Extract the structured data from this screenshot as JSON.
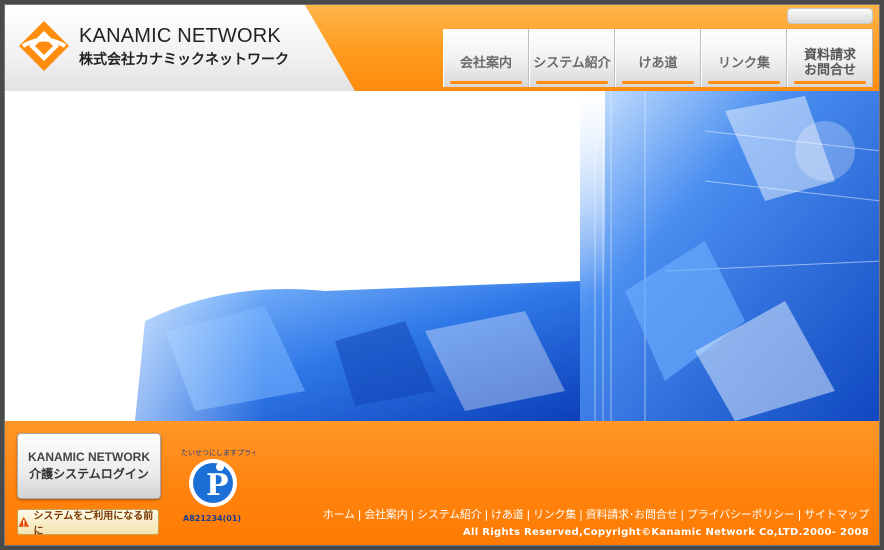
{
  "header": {
    "logo_en": "KANAMIC NETWORK",
    "logo_jp": "株式会社カナミックネットワーク"
  },
  "nav": {
    "items": [
      {
        "label": "会社案内"
      },
      {
        "label": "システム紹介"
      },
      {
        "label": "けあ道"
      },
      {
        "label": "リンク集"
      },
      {
        "label_line1": "資料請求",
        "label_line2": "お問合せ"
      }
    ]
  },
  "footer": {
    "login_line1": "KANAMIC NETWORK",
    "login_line2": "介護システムログイン",
    "notice": "システムをご利用になる前に",
    "pmark_text": "たいせつにしますプライバシー",
    "pmark_code": "A821234(01)",
    "links": [
      "ホーム",
      "会社案内",
      "システム紹介",
      "けあ道",
      "リンク集",
      "資料請求･お問合せ",
      "プライバシーポリシー",
      "サイトマップ"
    ],
    "copyright": "All Rights Reserved,Copyright©Kanamic Network Co,LTD.2000- 2008"
  },
  "colors": {
    "brand_orange": "#ff8c0d",
    "hero_blue": "#2a6fe0"
  }
}
